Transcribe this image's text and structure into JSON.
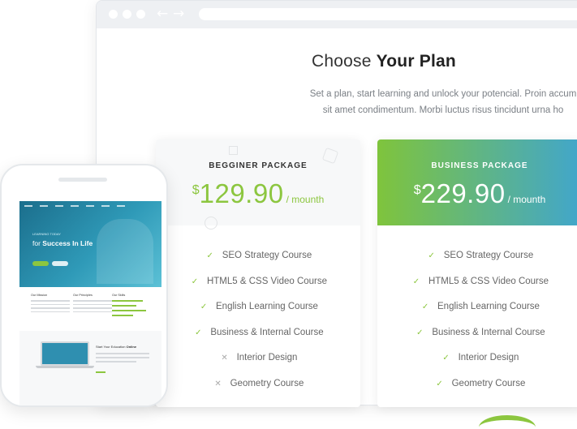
{
  "heading": {
    "light": "Choose ",
    "bold": "Your Plan"
  },
  "subtext": {
    "line1": "Set a plan, start learning and unlock your potencial. Proin accum",
    "line2": "sit amet condimentum. Morbi luctus risus tincidunt urna ho"
  },
  "browser": {
    "back_icon": "←",
    "forward_icon": "→"
  },
  "plans": [
    {
      "name": "BEGGINER PACKAGE",
      "currency": "$",
      "amount": "129.90",
      "period": "/ mounth",
      "features": [
        {
          "label": "SEO Strategy Course",
          "included": true,
          "icon": "check-icon"
        },
        {
          "label": "HTML5 & CSS Video Course",
          "included": true,
          "icon": "check-icon"
        },
        {
          "label": "English Learning Course",
          "included": true,
          "icon": "check-icon"
        },
        {
          "label": "Business & Internal Course",
          "included": true,
          "icon": "check-icon"
        },
        {
          "label": "Interior Design",
          "included": false,
          "icon": "cross-icon"
        },
        {
          "label": "Geometry Course",
          "included": false,
          "icon": "cross-icon"
        }
      ]
    },
    {
      "name": "BUSINESS PACKAGE",
      "currency": "$",
      "amount": "229.90",
      "period": "/ mounth",
      "features": [
        {
          "label": "SEO Strategy Course",
          "included": true,
          "icon": "check-icon"
        },
        {
          "label": "HTML5 & CSS Video Course",
          "included": true,
          "icon": "check-icon"
        },
        {
          "label": "English Learning Course",
          "included": true,
          "icon": "check-icon"
        },
        {
          "label": "Business & Internal Course",
          "included": true,
          "icon": "check-icon"
        },
        {
          "label": "Interior Design",
          "included": true,
          "icon": "check-icon"
        },
        {
          "label": "Geometry Course",
          "included": true,
          "icon": "check-icon"
        }
      ]
    }
  ],
  "phone": {
    "hero_small": "LEARNING TODAY",
    "hero_title_light": "for ",
    "hero_title_bold": "Success In Life",
    "columns": [
      "Our Mission",
      "Our Principles",
      "Our Skills"
    ],
    "footer_title_light": "Start Your Education ",
    "footer_title_bold": "Online"
  },
  "colors": {
    "accent_green": "#8cc63f",
    "accent_blue": "#41a6cc"
  }
}
